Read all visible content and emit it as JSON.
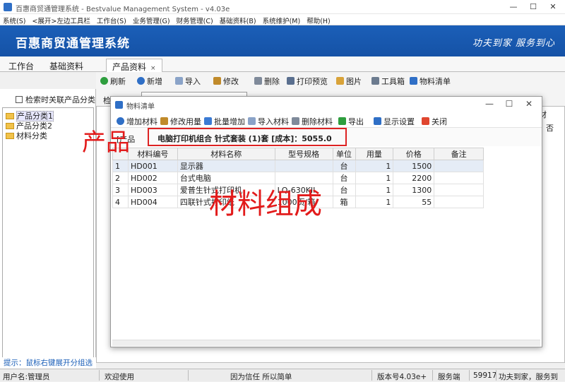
{
  "window": {
    "title": "百惠商贸通管理系统 - Bestvalue Management System - v4.03e",
    "minimize": "—",
    "maximize": "☐",
    "close": "✕"
  },
  "menu": [
    "系统(S)",
    "<展开>左边工具栏",
    "工作台(S)",
    "业务管理(G)",
    "财务管理(C)",
    "基础资料(B)",
    "系统维护(M)",
    "帮助(H)"
  ],
  "banner": {
    "title": "百惠商贸通管理系统",
    "slogan": "功夫到家  服务到心"
  },
  "tabs": [
    "工作台",
    "基础资料",
    "产品资料"
  ],
  "tab_close": "×",
  "toolbar": [
    "刷新",
    "新增",
    "导入",
    "修改",
    "删除",
    "打印预览",
    "图片",
    "工具箱",
    "物料清单"
  ],
  "left": {
    "checkbox_label": "检索时关联产品分类",
    "tree": [
      "产品分类1",
      "产品分类2",
      "材料分类"
    ],
    "hint": "提示：鼠标右键展开分组选项"
  },
  "search": {
    "label": "检索关键词"
  },
  "main_grid": {
    "header_fragment": "材",
    "value_fragment": "否"
  },
  "dialog": {
    "title": "物料清单",
    "minimize": "—",
    "maximize": "☐",
    "close": "✕",
    "toolbar": [
      "增加材料",
      "修改用量",
      "批量增加",
      "导入材料",
      "删除材料",
      "导出",
      "显示设置",
      "关闭"
    ],
    "code_tag": "[产品",
    "summary": "电脑打印机组合  针式套装    (1)套    [成本]：5055.0",
    "table": {
      "headers": [
        "",
        "材料编号",
        "材料名称",
        "型号规格",
        "单位",
        "用量",
        "价格",
        "备注"
      ],
      "rows": [
        [
          "1",
          "HD001",
          "显示器",
          "",
          "台",
          "1",
          "1500",
          ""
        ],
        [
          "2",
          "HD002",
          "台式电脑",
          "",
          "台",
          "1",
          "2200",
          ""
        ],
        [
          "3",
          "HD003",
          "爱普生针式打印机",
          "LQ-630KII",
          "台",
          "1",
          "1300",
          ""
        ],
        [
          "4",
          "HD004",
          "四联针式打印纸",
          "1000页/箱",
          "箱",
          "1",
          "55",
          ""
        ]
      ]
    }
  },
  "annotations": {
    "product": "产品",
    "material": "材料组成"
  },
  "status": [
    "用户名:管理员",
    "欢迎使用",
    "因为信任 所以简单",
    "版本号4.03e+",
    "服务端",
    "59917",
    "功夫到家，服务到"
  ],
  "colors": {
    "banner": "#1552a6",
    "annotation_red": "#e21b1b",
    "box_red": "#dd2222"
  }
}
